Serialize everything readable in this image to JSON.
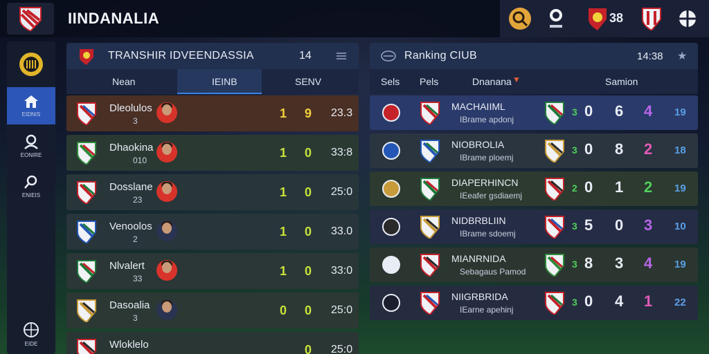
{
  "app": {
    "title": "IINDANALIA",
    "top_count": "38"
  },
  "sidebar": {
    "items": [
      {
        "label": "",
        "icon": "club-badge-icon"
      },
      {
        "label": "EIDNIS",
        "icon": "home-icon"
      },
      {
        "label": "EONIRE",
        "icon": "user-icon"
      },
      {
        "label": "ENIEIS",
        "icon": "search-icon"
      },
      {
        "label": "EIDE",
        "icon": "globe-icon"
      }
    ]
  },
  "transfer": {
    "title": "TRANSHIR IDVEENDASSIA",
    "count": "14",
    "tabs": [
      "Nean",
      "IEINB",
      "SENV"
    ],
    "rows": [
      {
        "name": "Dleolulos",
        "sub": "3",
        "a": "1",
        "b": "9",
        "c": "23.3",
        "a_color": "#f2d23a",
        "b_color": "#f2d23a"
      },
      {
        "name": "Dhaokina",
        "sub": "010",
        "a": "1",
        "b": "0",
        "c": "33:8",
        "a_color": "#c9e33a",
        "b_color": "#c9e33a"
      },
      {
        "name": "Dosslane",
        "sub": "23",
        "a": "1",
        "b": "0",
        "c": "25:0",
        "a_color": "#c9e33a",
        "b_color": "#c9e33a"
      },
      {
        "name": "Venoolos",
        "sub": "2",
        "a": "1",
        "b": "0",
        "c": "33.0",
        "a_color": "#c9e33a",
        "b_color": "#c9e33a"
      },
      {
        "name": "Nlvalert",
        "sub": "33",
        "a": "1",
        "b": "0",
        "c": "33:0",
        "a_color": "#c9e33a",
        "b_color": "#c9e33a"
      },
      {
        "name": "Dasoalia",
        "sub": "3",
        "a": "0",
        "b": "0",
        "c": "25:0",
        "a_color": "#c9e33a",
        "b_color": "#c9e33a"
      },
      {
        "name": "Wloklelo",
        "sub": "",
        "a": "",
        "b": "0",
        "c": "25:0",
        "a_color": "#c9e33a",
        "b_color": "#c9e33a"
      }
    ]
  },
  "ranking": {
    "title": "Ranking CIUB",
    "count": "14:38",
    "columns": [
      "Sels",
      "Pels",
      "Dnanana",
      "Samion"
    ],
    "rows": [
      {
        "name": "MACHAIIML",
        "sub": "IBrame apdonj",
        "n1": "3",
        "n2": "0",
        "n3": "6",
        "n4": "4",
        "n5": "19",
        "c4": "#b767e8"
      },
      {
        "name": "NIOBROLIA",
        "sub": "IBrame ploemj",
        "n1": "3",
        "n2": "0",
        "n3": "8",
        "n4": "2",
        "n5": "18",
        "c4": "#e25bb5"
      },
      {
        "name": "DIAPERHINCN",
        "sub": "IEeafer gsdiaemj",
        "n1": "2",
        "n2": "0",
        "n3": "1",
        "n4": "2",
        "n5": "19",
        "c4": "#4fd05a"
      },
      {
        "name": "NIDBRBLIIN",
        "sub": "IBrame sdoemj",
        "n1": "3",
        "n2": "5",
        "n3": "0",
        "n4": "3",
        "n5": "10",
        "c4": "#b767e8"
      },
      {
        "name": "MIANRNIDA",
        "sub": "Sebagaus Pamod",
        "n1": "3",
        "n2": "8",
        "n3": "3",
        "n4": "4",
        "n5": "19",
        "c4": "#b767e8"
      },
      {
        "name": "NIIGRBRIDA",
        "sub": "IEarne apehinj",
        "n1": "3",
        "n2": "0",
        "n3": "4",
        "n4": "1",
        "n5": "22",
        "c4": "#e25bb5"
      }
    ]
  },
  "colors": {
    "accent": "#3d82e6",
    "green": "#4fd05a",
    "yellow": "#f2d23a"
  }
}
